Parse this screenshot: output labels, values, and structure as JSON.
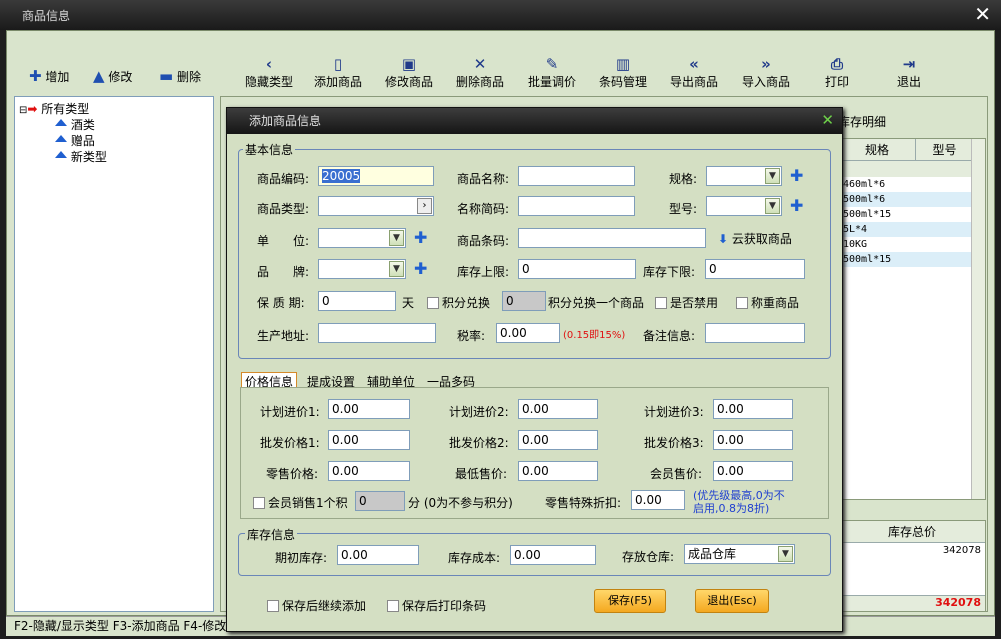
{
  "window": {
    "title": "商品信息"
  },
  "left_toolbar": [
    "增加",
    "修改",
    "删除"
  ],
  "toolbar": [
    "隐藏类型",
    "添加商品",
    "修改商品",
    "删除商品",
    "批量调价",
    "条码管理",
    "导出商品",
    "导入商品",
    "打印",
    "退出"
  ],
  "tree": {
    "root": "所有类型",
    "children": [
      "酒类",
      "赠品",
      "新类型"
    ]
  },
  "main_tab": "库存明细",
  "grid": {
    "headers": [
      "规格",
      "型号"
    ],
    "rows": [
      "460ml*6",
      "500ml*6",
      "500ml*15",
      "5L*4",
      "10KG",
      "500ml*15"
    ]
  },
  "grid2": {
    "header": "库存总价",
    "value": "342078",
    "total": "342078"
  },
  "statusbar": "F2-隐藏/显示类型  F3-添加商品  F4-修改",
  "dialog": {
    "title": "添加商品信息",
    "basic": {
      "legend": "基本信息",
      "code_label": "商品编码:",
      "code_value": "20005",
      "name_label": "商品名称:",
      "spec_label": "规格:",
      "type_label": "商品类型:",
      "short_label": "名称简码:",
      "model_label": "型号:",
      "unit_label": "单　　位:",
      "barcode_label": "商品条码:",
      "cloud_label": "云获取商品",
      "brand_label": "品　　牌:",
      "stock_upper_label": "库存上限:",
      "stock_upper_value": "0",
      "stock_lower_label": "库存下限:",
      "stock_lower_value": "0",
      "shelf_label": "保 质 期:",
      "shelf_value": "0",
      "day_label": "天",
      "points_exchange": "积分兑换",
      "points_value": "0",
      "points_suffix": "积分兑换一个商品",
      "disabled_label": "是否禁用",
      "weigh_label": "称重商品",
      "address_label": "生产地址:",
      "tax_label": "税率:",
      "tax_value": "0.00",
      "tax_hint": "(0.15即15%)",
      "remark_label": "备注信息:"
    },
    "tabs": [
      "价格信息",
      "提成设置",
      "辅助单位",
      "一品多码"
    ],
    "price": {
      "plan1_label": "计划进价1:",
      "plan1": "0.00",
      "plan2_label": "计划进价2:",
      "plan2": "0.00",
      "plan3_label": "计划进价3:",
      "plan3": "0.00",
      "whole1_label": "批发价格1:",
      "whole1": "0.00",
      "whole2_label": "批发价格2:",
      "whole2": "0.00",
      "whole3_label": "批发价格3:",
      "whole3": "0.00",
      "retail_label": "零售价格:",
      "retail": "0.00",
      "min_label": "最低售价:",
      "min": "0.00",
      "member_label": "会员售价:",
      "member": "0.00",
      "member_points_label": "会员销售1个积",
      "member_points_value": "0",
      "member_points_suffix": "分 (0为不参与积分)",
      "discount_label": "零售特殊折扣:",
      "discount": "0.00",
      "discount_hint_1": "(优先级最高,0为不",
      "discount_hint_2": "启用,0.8为8折)"
    },
    "stock": {
      "legend": "库存信息",
      "initial_label": "期初库存:",
      "initial": "0.00",
      "cost_label": "库存成本:",
      "cost": "0.00",
      "warehouse_label": "存放仓库:",
      "warehouse": "成品仓库"
    },
    "continue_label": "保存后继续添加",
    "print_label": "保存后打印条码",
    "save_button": "保存(F5)",
    "exit_button": "退出(Esc)"
  }
}
